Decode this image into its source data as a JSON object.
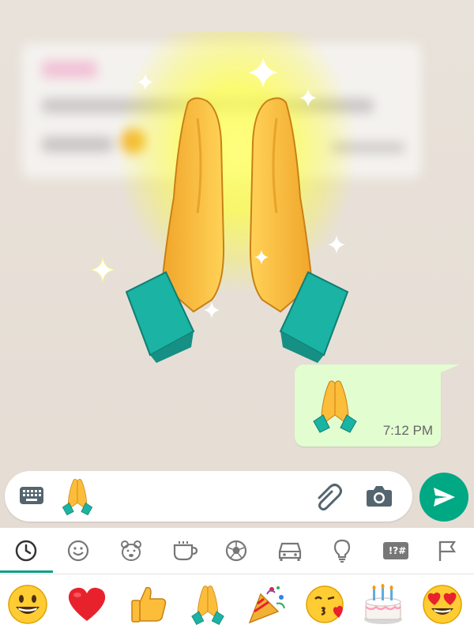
{
  "chat": {
    "message": {
      "emoji": "folded-hands-emoji",
      "time": "7:12 PM"
    }
  },
  "composer": {
    "emoji": "folded-hands-emoji",
    "icons": [
      "keyboard-icon",
      "attach-icon",
      "camera-icon",
      "send-icon"
    ]
  },
  "emoji_panel": {
    "tabs": [
      {
        "name": "recent-icon",
        "active": true
      },
      {
        "name": "smileys-icon",
        "active": false
      },
      {
        "name": "animals-icon",
        "active": false
      },
      {
        "name": "food-icon",
        "active": false
      },
      {
        "name": "activity-icon",
        "active": false
      },
      {
        "name": "travel-icon",
        "active": false
      },
      {
        "name": "objects-icon",
        "active": false
      },
      {
        "name": "symbols-icon",
        "label": "!?#",
        "active": false
      },
      {
        "name": "flags-icon",
        "active": false
      }
    ],
    "recent_emojis": [
      "grinning-face",
      "red-heart",
      "thumbs-up",
      "folded-hands",
      "party-popper",
      "kissing-face",
      "birthday-cake",
      "heart-eyes"
    ]
  },
  "colors": {
    "accent": "#00a884",
    "bubble": "#e2fdd0",
    "sleeve": "#1bb3a3",
    "skin": "#f7b733"
  }
}
